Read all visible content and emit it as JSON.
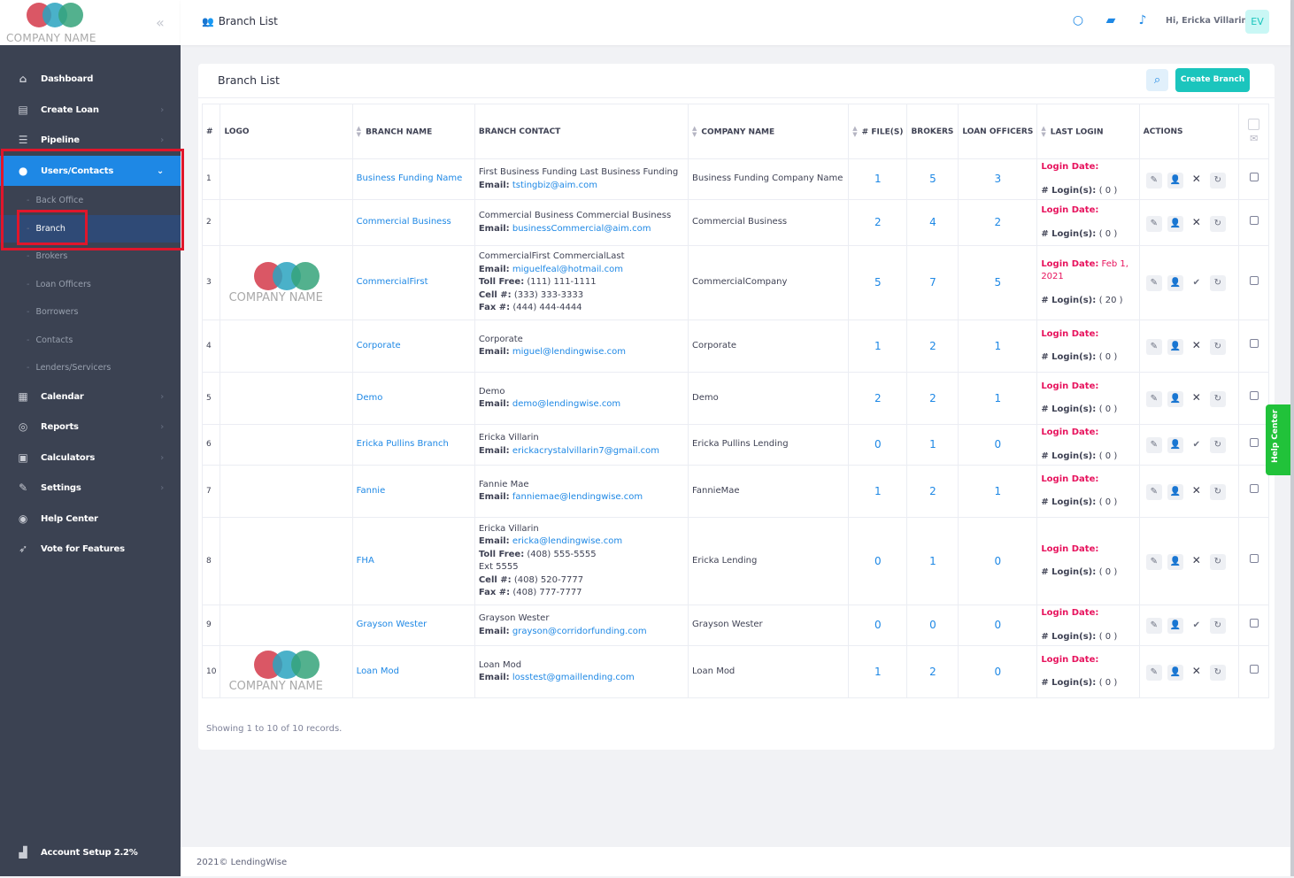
{
  "logo": {
    "text": "COMPANY NAME",
    "colors": [
      "#d43a4a",
      "#2aa3c0",
      "#35a37a"
    ]
  },
  "sidebar": {
    "items": [
      {
        "label": "Dashboard",
        "icon": "home-icon"
      },
      {
        "label": "Create Loan",
        "icon": "file-icon"
      },
      {
        "label": "Pipeline",
        "icon": "list-icon"
      },
      {
        "label": "Users/Contacts",
        "icon": "users-icon"
      },
      {
        "label": "Calendar",
        "icon": "calendar-icon"
      },
      {
        "label": "Reports",
        "icon": "reports-icon"
      },
      {
        "label": "Calculators",
        "icon": "calculator-icon"
      },
      {
        "label": "Settings",
        "icon": "wrench-icon"
      },
      {
        "label": "Help Center",
        "icon": "lifebuoy-icon"
      },
      {
        "label": "Vote for Features",
        "icon": "rocket-icon"
      }
    ],
    "subitems": [
      "Back Office",
      "Branch",
      "Brokers",
      "Loan Officers",
      "Borrowers",
      "Contacts",
      "Lenders/Servicers"
    ],
    "account_setup": "Account Setup 2.2%"
  },
  "topbar": {
    "title": "Branch List",
    "greeting": "Hi, Ericka Villarin",
    "avatar_initials": "EV"
  },
  "card": {
    "title": "Branch List",
    "create_label": "Create Branch",
    "showing": "Showing 1 to 10 of 10 records."
  },
  "table": {
    "headers": {
      "num": "#",
      "logo": "LOGO",
      "branch_name": "BRANCH NAME",
      "branch_contact": "BRANCH CONTACT",
      "company_name": "COMPANY NAME",
      "files": "# FILE(S)",
      "brokers": "BROKERS",
      "loan_officers": "LOAN OFFICERS",
      "last_login": "LAST LOGIN",
      "actions": "ACTIONS"
    },
    "labels": {
      "email": "Email:",
      "toll_free": "Toll Free:",
      "cell": "Cell #:",
      "fax": "Fax #:",
      "login_date": "Login Date:",
      "logins": "# Login(s):"
    },
    "rows": [
      {
        "n": "1",
        "logo": false,
        "branch": "Business Funding Name",
        "contact_name": "First Business Funding Last Business Funding",
        "email": "tstingbiz@aim.com",
        "company": "Business Funding Company Name",
        "files": "1",
        "brokers": "5",
        "los": "3",
        "login_date": "",
        "logins": "( 0 )",
        "status": "x"
      },
      {
        "n": "2",
        "logo": false,
        "branch": "Commercial Business",
        "contact_name": "Commercial Business Commercial Business",
        "email": "businessCommercial@aim.com",
        "company": "Commercial Business",
        "files": "2",
        "brokers": "4",
        "los": "2",
        "login_date": "",
        "logins": "( 0 )",
        "status": "x"
      },
      {
        "n": "3",
        "logo": true,
        "branch": "CommercialFirst",
        "contact_name": "CommercialFirst CommercialLast",
        "email": "miguelfeal@hotmail.com",
        "toll_free": "(111) 111-1111",
        "cell": "(333) 333-3333",
        "fax": "(444) 444-4444",
        "company": "CommercialCompany",
        "files": "5",
        "brokers": "7",
        "los": "5",
        "login_date": "Feb 1, 2021",
        "logins": "( 20 )",
        "status": "check"
      },
      {
        "n": "4",
        "logo": false,
        "branch": "Corporate",
        "contact_name": "Corporate",
        "email": "miguel@lendingwise.com",
        "company": "Corporate",
        "files": "1",
        "brokers": "2",
        "los": "1",
        "login_date": "",
        "logins": "( 0 )",
        "status": "x"
      },
      {
        "n": "5",
        "logo": false,
        "branch": "Demo",
        "contact_name": "Demo",
        "email": "demo@lendingwise.com",
        "company": "Demo",
        "files": "2",
        "brokers": "2",
        "los": "1",
        "login_date": "",
        "logins": "( 0 )",
        "status": "x"
      },
      {
        "n": "6",
        "logo": false,
        "branch": "Ericka Pullins Branch",
        "contact_name": "Ericka Villarin",
        "email": "erickacrystalvillarin7@gmail.com",
        "company": "Ericka Pullins Lending",
        "files": "0",
        "brokers": "1",
        "los": "0",
        "login_date": "",
        "logins": "( 0 )",
        "status": "check"
      },
      {
        "n": "7",
        "logo": false,
        "branch": "Fannie",
        "contact_name": "Fannie Mae",
        "email": "fanniemae@lendingwise.com",
        "company": "FannieMae",
        "files": "1",
        "brokers": "2",
        "los": "1",
        "login_date": "",
        "logins": "( 0 )",
        "status": "x"
      },
      {
        "n": "8",
        "logo": false,
        "branch": "FHA",
        "contact_name": "Ericka Villarin",
        "email": "ericka@lendingwise.com",
        "toll_free": "(408) 555-5555",
        "ext": "Ext 5555",
        "cell": "(408) 520-7777",
        "fax": "(408) 777-7777",
        "company": "Ericka Lending",
        "files": "0",
        "brokers": "1",
        "los": "0",
        "login_date": "",
        "logins": "( 0 )",
        "status": "x"
      },
      {
        "n": "9",
        "logo": false,
        "branch": "Grayson Wester",
        "contact_name": "Grayson Wester",
        "email": "grayson@corridorfunding.com",
        "company": "Grayson Wester",
        "files": "0",
        "brokers": "0",
        "los": "0",
        "login_date": "",
        "logins": "( 0 )",
        "status": "check"
      },
      {
        "n": "10",
        "logo": true,
        "branch": "Loan Mod",
        "contact_name": "Loan Mod",
        "email": "losstest@gmaillending.com",
        "company": "Loan Mod",
        "files": "1",
        "brokers": "2",
        "los": "0",
        "login_date": "",
        "logins": "( 0 )",
        "status": "x"
      }
    ]
  },
  "help_tab": "Help Center",
  "footer": "2021© LendingWise"
}
